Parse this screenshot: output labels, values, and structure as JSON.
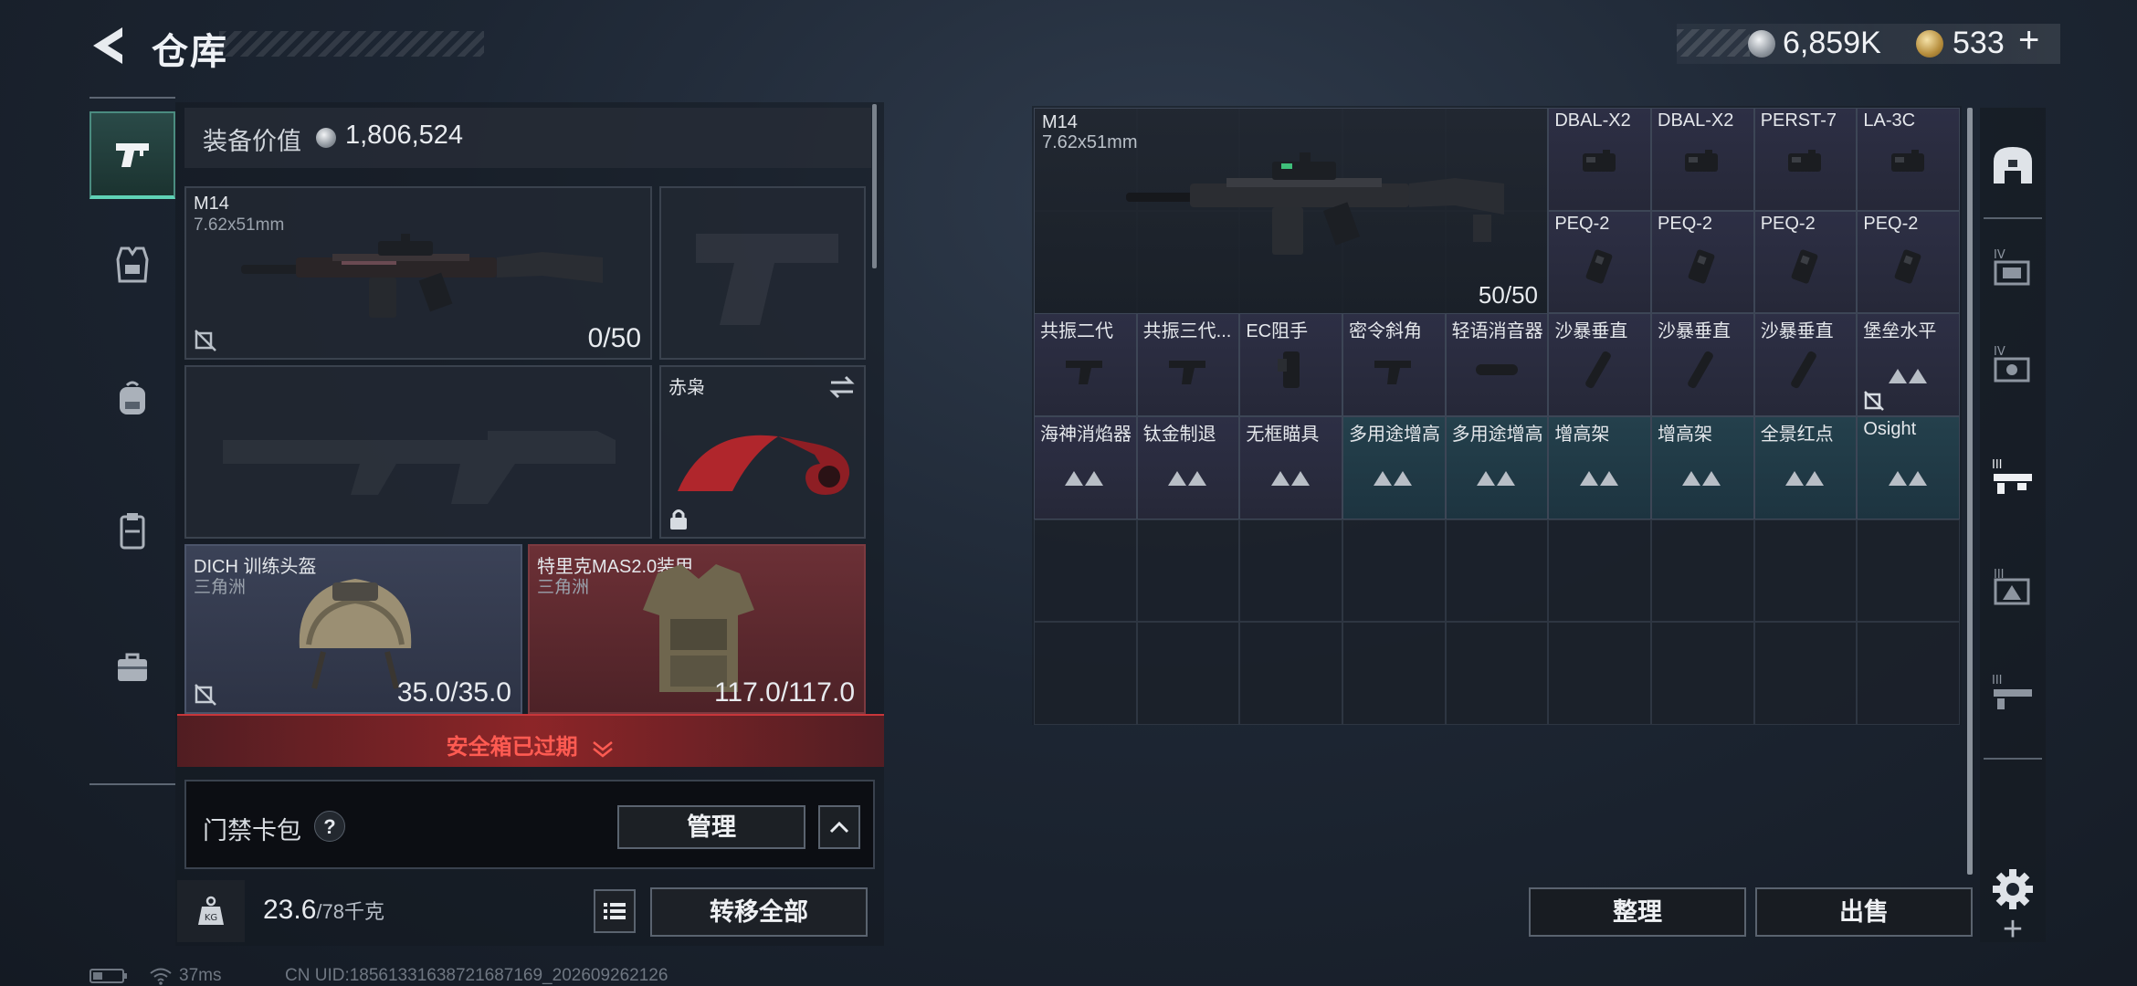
{
  "header": {
    "title": "仓库",
    "currency": {
      "silver_value": "6,859K",
      "gold_value": "533",
      "gold_add": "+"
    }
  },
  "loadout": {
    "equip_value_label": "装备价值",
    "equip_value": "1,806,524",
    "primary": {
      "name": "M14",
      "caliber": "7.62x51mm",
      "ammo": "0/50"
    },
    "melee": {
      "name": "赤枭"
    },
    "helmet": {
      "name": "DICH 训练头盔",
      "origin": "三角洲",
      "durability": "35.0/35.0"
    },
    "armor": {
      "name": "特里克MAS2.0装甲",
      "origin": "三角洲",
      "durability": "117.0/117.0"
    },
    "safebox_status": "安全箱已过期",
    "keycard_label": "门禁卡包",
    "keycard_help": "?",
    "manage_label": "管理",
    "weight": "23.6",
    "weight_max": "/78千克",
    "transfer_all_label": "转移全部"
  },
  "status": {
    "ping": "37ms",
    "uid": "CN UID:18561331638721687169_202609262126"
  },
  "storage": {
    "main_item": {
      "name": "M14",
      "caliber": "7.62x51mm",
      "ammo": "50/50"
    },
    "items": [
      {
        "name": "DBAL-X2",
        "kind": "laser"
      },
      {
        "name": "DBAL-X2",
        "kind": "laser"
      },
      {
        "name": "PERST-7",
        "kind": "laser"
      },
      {
        "name": "LA-3C",
        "kind": "laser"
      },
      {
        "name": "PEQ-2",
        "kind": "peq"
      },
      {
        "name": "PEQ-2",
        "kind": "peq"
      },
      {
        "name": "PEQ-2",
        "kind": "peq"
      },
      {
        "name": "PEQ-2",
        "kind": "peq"
      },
      {
        "name": "共振二代",
        "kind": "grip"
      },
      {
        "name": "共振三代...",
        "kind": "grip"
      },
      {
        "name": "EC阻手",
        "kind": "holster"
      },
      {
        "name": "密令斜角",
        "kind": "grip"
      },
      {
        "name": "轻语消音器",
        "kind": "suppressor"
      },
      {
        "name": "沙暴垂直",
        "kind": "vgrip"
      },
      {
        "name": "沙暴垂直",
        "kind": "vgrip"
      },
      {
        "name": "沙暴垂直",
        "kind": "vgrip"
      },
      {
        "name": "堡垒水平",
        "kind": "placeholder"
      },
      {
        "name": "海神消焰器",
        "kind": "placeholder"
      },
      {
        "name": "钛金制退",
        "kind": "placeholder"
      },
      {
        "name": "无框瞄具",
        "kind": "placeholder"
      },
      {
        "name": "多用途增高",
        "kind": "placeholder"
      },
      {
        "name": "多用途增高",
        "kind": "placeholder"
      },
      {
        "name": "增高架",
        "kind": "placeholder"
      },
      {
        "name": "增高架",
        "kind": "placeholder"
      },
      {
        "name": "全景红点",
        "kind": "placeholder"
      },
      {
        "name": "Osight",
        "kind": "placeholder"
      }
    ],
    "tidy_label": "整理",
    "sell_label": "出售"
  },
  "right_nav": {
    "add_label": "+"
  },
  "colors": {
    "accent_teal": "#5fd2b6",
    "alert_red": "#ff5b52",
    "helmet_bg": "#3b4257",
    "armor_bg": "#6c3036"
  }
}
